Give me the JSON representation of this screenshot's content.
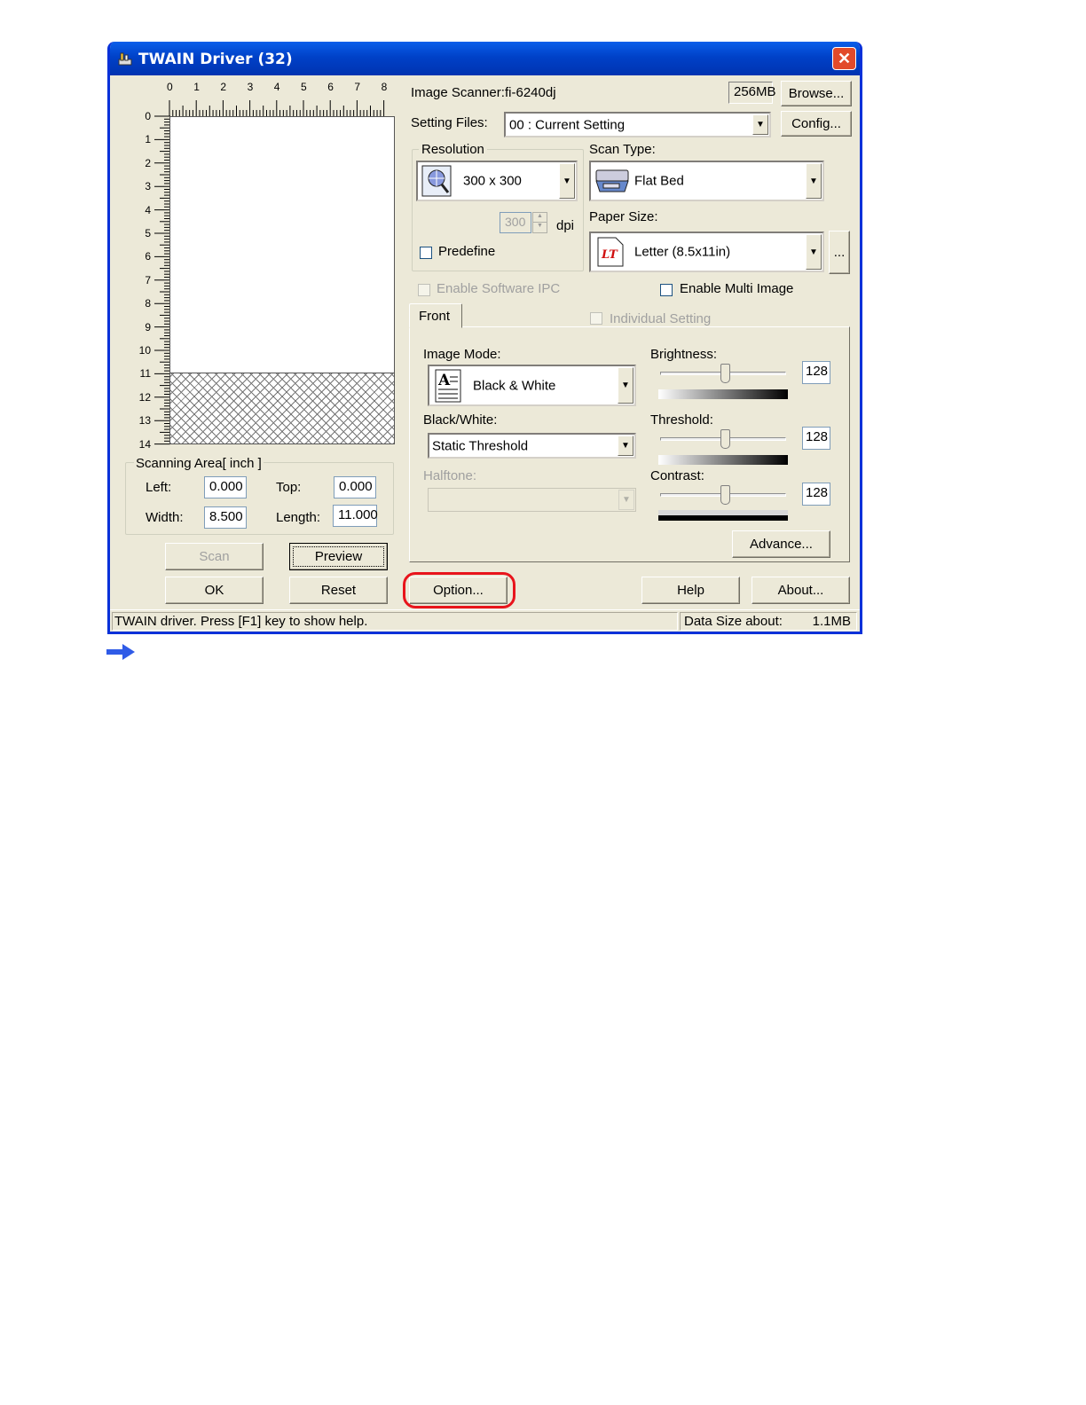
{
  "window": {
    "title": "TWAIN Driver (32)",
    "close_glyph": "✕"
  },
  "ruler": {
    "top_ticks": [
      "0",
      "1",
      "2",
      "3",
      "4",
      "5",
      "6",
      "7",
      "8"
    ],
    "left_ticks": [
      "0",
      "1",
      "2",
      "3",
      "4",
      "5",
      "6",
      "7",
      "8",
      "9",
      "10",
      "11",
      "12",
      "13",
      "14"
    ]
  },
  "scanning_area": {
    "legend": "Scanning Area[ inch ]",
    "left_label": "Left:",
    "left_value": "0.000",
    "top_label": "Top:",
    "top_value": "0.000",
    "width_label": "Width:",
    "width_value": "8.500",
    "length_label": "Length:",
    "length_value": "11.000"
  },
  "buttons_left": {
    "scan": "Scan",
    "preview": "Preview",
    "ok": "OK",
    "reset": "Reset"
  },
  "scanner": {
    "label": "Image Scanner:",
    "model": "fi-6240dj",
    "memory": "256MB",
    "browse": "Browse...",
    "setting_files_label": "Setting Files:",
    "setting_files_value": "00 : Current Setting",
    "config": "Config..."
  },
  "resolution": {
    "legend": "Resolution",
    "value": "300 x 300",
    "dpi_value": "300",
    "dpi_label": "dpi",
    "predefine": "Predefine"
  },
  "scan_type": {
    "label": "Scan Type:",
    "value": "Flat Bed"
  },
  "paper_size": {
    "label": "Paper Size:",
    "value": "Letter (8.5x11in)",
    "more": "..."
  },
  "options": {
    "enable_ipc": "Enable Software IPC",
    "enable_multi": "Enable Multi Image",
    "individual": "Individual Setting"
  },
  "tab": {
    "front": "Front"
  },
  "image": {
    "mode_label": "Image Mode:",
    "mode_value": "Black & White",
    "bw_label": "Black/White:",
    "bw_value": "Static Threshold",
    "halftone_label": "Halftone:"
  },
  "adjust": {
    "brightness_label": "Brightness:",
    "brightness_value": "128",
    "threshold_label": "Threshold:",
    "threshold_value": "128",
    "contrast_label": "Contrast:",
    "contrast_value": "128",
    "advance": "Advance..."
  },
  "bottom_buttons": {
    "option": "Option...",
    "help": "Help",
    "about": "About..."
  },
  "status": {
    "message": "TWAIN driver. Press [F1] key to show help.",
    "data_size_label": "Data Size about:",
    "data_size_value": "1.1MB"
  },
  "colors": {
    "titlebar": "#0A5FEA",
    "highlight": "#E8141C",
    "arrow": "#2F5BE7"
  }
}
